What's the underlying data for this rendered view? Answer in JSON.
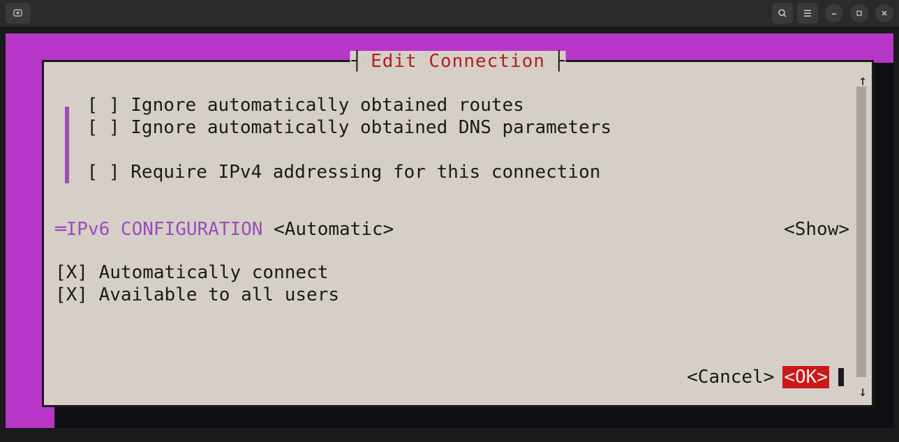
{
  "titlebar": {
    "new_tab_icon": "⊕"
  },
  "dialog": {
    "title": "Edit Connection",
    "options": {
      "ignore_routes": {
        "checked": false,
        "label": "Ignore automatically obtained routes"
      },
      "ignore_dns": {
        "checked": false,
        "label": "Ignore automatically obtained DNS parameters"
      },
      "require_ipv4": {
        "checked": false,
        "label": "Require IPv4 addressing for this connection"
      }
    },
    "ipv6": {
      "heading": "IPv6 CONFIGURATION",
      "value": "<Automatic>",
      "action": "<Show>"
    },
    "auto_connect": {
      "checked": true,
      "label": "Automatically connect"
    },
    "all_users": {
      "checked": true,
      "label": "Available to all users"
    },
    "buttons": {
      "cancel": "<Cancel>",
      "ok": "<OK>"
    }
  }
}
